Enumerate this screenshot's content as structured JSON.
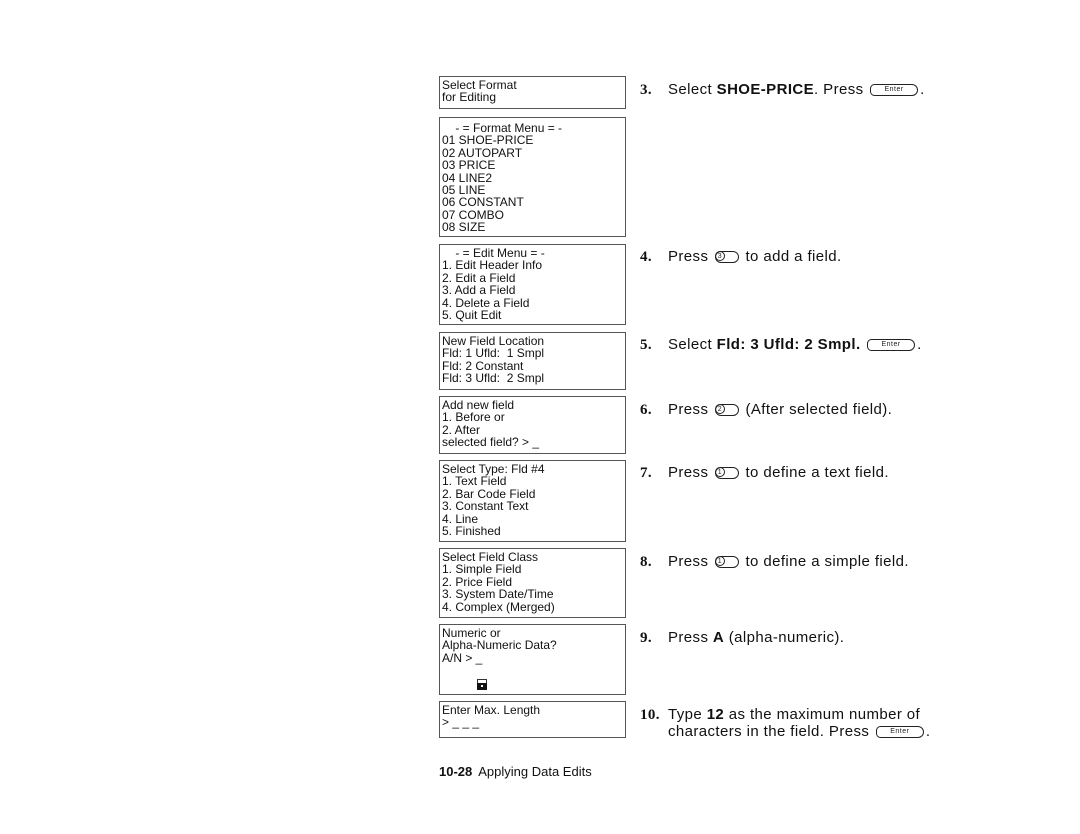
{
  "screens": [
    {
      "name": "select-format-screen",
      "lines": [
        "Select Format",
        "for Editing"
      ]
    },
    {
      "name": "format-menu-screen",
      "lines": [
        "    - = Format Menu = -",
        "01 SHOE-PRICE",
        "02 AUTOPART",
        "03 PRICE",
        "04 LINE2",
        "05 LINE",
        "06 CONSTANT",
        "07 COMBO",
        "08 SIZE"
      ]
    },
    {
      "name": "edit-menu-screen",
      "lines": [
        "    - = Edit Menu = -",
        "1. Edit Header Info",
        "2. Edit a Field",
        "3. Add a Field",
        "4. Delete a Field",
        "5. Quit Edit"
      ]
    },
    {
      "name": "new-field-location-screen",
      "lines": [
        "New Field Location",
        "Fld: 1 Ufld:  1 Smpl",
        "Fld: 2 Constant",
        "Fld: 3 Ufld:  2 Smpl"
      ]
    },
    {
      "name": "add-new-field-screen",
      "lines": [
        "Add new field",
        "1. Before or",
        "2. After",
        "selected field? > _"
      ]
    },
    {
      "name": "select-type-screen",
      "lines": [
        "Select Type: Fld #4",
        "1. Text Field",
        "2. Bar Code Field",
        "3. Constant Text",
        "4. Line",
        "5. Finished"
      ]
    },
    {
      "name": "select-field-class-screen",
      "lines": [
        "Select Field Class",
        "1. Simple Field",
        "2. Price Field",
        "3. System Date/Time",
        "4. Complex (Merged)"
      ]
    },
    {
      "name": "numeric-or-alpha-screen",
      "lines": [
        "Numeric or",
        "Alpha-Numeric Data?",
        "A/N > _"
      ],
      "icon": "lock-icon"
    },
    {
      "name": "enter-max-length-screen",
      "lines": [
        "Enter Max. Length",
        "> _ _ _"
      ]
    }
  ],
  "steps": {
    "s3": {
      "num": "3.",
      "pre": "Select ",
      "bold": "SHOE-PRICE",
      "post": ".  Press ",
      "key": "Enter",
      "end": "."
    },
    "s4": {
      "num": "4.",
      "pre": "Press ",
      "key": "3",
      "post": " to add a field."
    },
    "s5": {
      "num": "5.",
      "pre": "Select ",
      "bold": "Fld:  3 Ufld:  2 Smpl.",
      "key": "Enter",
      "end": "."
    },
    "s6": {
      "num": "6.",
      "pre": "Press ",
      "key": "2",
      "post": " (After selected field)."
    },
    "s7": {
      "num": "7.",
      "pre": "Press ",
      "key": "1",
      "post": " to define a text field."
    },
    "s8": {
      "num": "8.",
      "pre": "Press ",
      "key": "1",
      "post": " to define a simple field."
    },
    "s9": {
      "num": "9.",
      "pre": "Press ",
      "bold": "A",
      "post": " (alpha-numeric)."
    },
    "s10": {
      "num": "10.",
      "pre": "Type ",
      "bold": "12",
      "post": " as the maximum number of",
      "line2": "characters in the field.  Press ",
      "key": "Enter",
      "end": "."
    }
  },
  "footer": {
    "page": "10-28",
    "title": "Applying Data Edits"
  }
}
